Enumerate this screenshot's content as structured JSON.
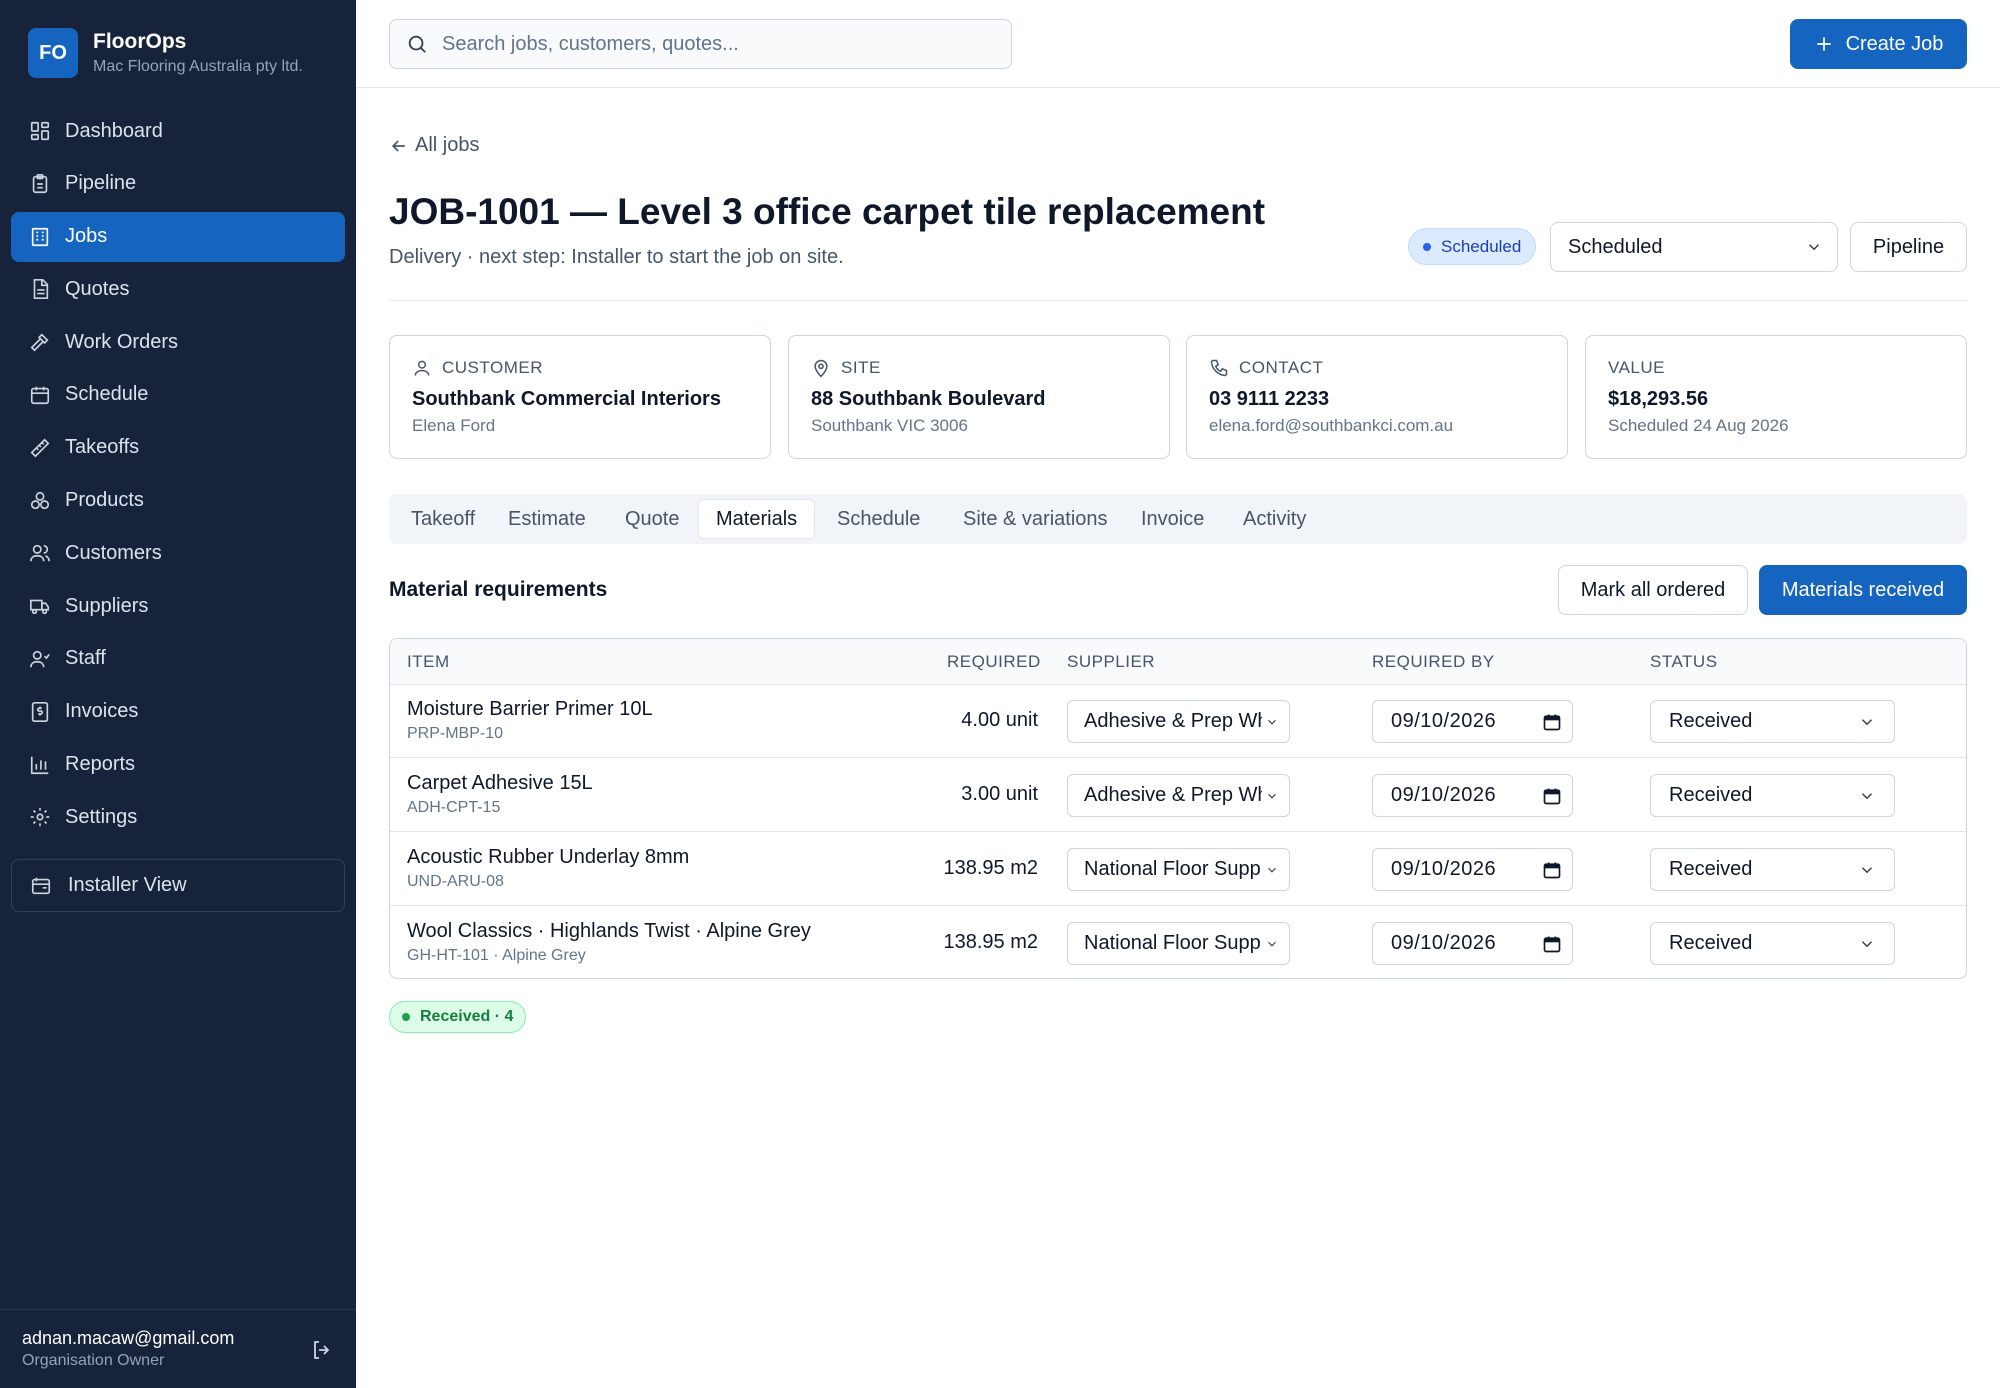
{
  "brand": {
    "logo": "FO",
    "name": "FloorOps",
    "org": "Mac Flooring Australia pty ltd."
  },
  "sidebar": {
    "items": [
      {
        "label": "Dashboard",
        "icon": "dashboard-icon"
      },
      {
        "label": "Pipeline",
        "icon": "clipboard-icon"
      },
      {
        "label": "Jobs",
        "icon": "building-icon",
        "active": true
      },
      {
        "label": "Quotes",
        "icon": "document-icon"
      },
      {
        "label": "Work Orders",
        "icon": "hammer-icon"
      },
      {
        "label": "Schedule",
        "icon": "calendar-icon"
      },
      {
        "label": "Takeoffs",
        "icon": "ruler-icon"
      },
      {
        "label": "Products",
        "icon": "boxes-icon"
      },
      {
        "label": "Customers",
        "icon": "users-icon"
      },
      {
        "label": "Suppliers",
        "icon": "truck-icon"
      },
      {
        "label": "Staff",
        "icon": "staff-icon"
      },
      {
        "label": "Invoices",
        "icon": "invoice-icon"
      },
      {
        "label": "Reports",
        "icon": "bar-chart-icon"
      },
      {
        "label": "Settings",
        "icon": "gear-icon"
      }
    ],
    "installer": "Installer View",
    "user": {
      "email": "adnan.macaw@gmail.com",
      "role": "Organisation Owner"
    }
  },
  "topbar": {
    "search_placeholder": "Search jobs, customers, quotes...",
    "create_label": "Create Job"
  },
  "job": {
    "back_label": "All jobs",
    "title": "JOB-1001 — Level 3 office carpet tile replacement",
    "subtitle": "Delivery · next step: Installer to start the job on site.",
    "status_pill": "Scheduled",
    "status_select": "Scheduled",
    "pipeline_label": "Pipeline"
  },
  "cards": [
    {
      "label": "CUSTOMER",
      "icon": "user-icon",
      "value": "Southbank Commercial Interiors",
      "sub": "Elena Ford"
    },
    {
      "label": "SITE",
      "icon": "map-pin-icon",
      "value": "88 Southbank Boulevard",
      "sub": "Southbank VIC 3006"
    },
    {
      "label": "CONTACT",
      "icon": "phone-icon",
      "value": "03 9111 2233",
      "sub": "elena.ford@southbankci.com.au"
    },
    {
      "label": "VALUE",
      "value": "$18,293.56",
      "sub": "Scheduled 24 Aug 2026"
    }
  ],
  "tabs": [
    "Takeoff",
    "Estimate",
    "Quote",
    "Materials",
    "Schedule",
    "Site & variations",
    "Invoice",
    "Activity"
  ],
  "active_tab": "Materials",
  "materials": {
    "title": "Material requirements",
    "mark_all_label": "Mark all ordered",
    "received_label": "Materials received",
    "columns": [
      "ITEM",
      "REQUIRED",
      "SUPPLIER",
      "REQUIRED BY",
      "STATUS"
    ],
    "rows": [
      {
        "name": "Moisture Barrier Primer 10L",
        "code": "PRP-MBP-10",
        "qty": "4.00 unit",
        "supplier": "Adhesive & Prep Wh",
        "date": "09/10/2026",
        "status": "Received"
      },
      {
        "name": "Carpet Adhesive 15L",
        "code": "ADH-CPT-15",
        "qty": "3.00 unit",
        "supplier": "Adhesive & Prep Wh",
        "date": "09/10/2026",
        "status": "Received"
      },
      {
        "name": "Acoustic Rubber Underlay 8mm",
        "code": "UND-ARU-08",
        "qty": "138.95 m2",
        "supplier": "National Floor Supp",
        "date": "09/10/2026",
        "status": "Received"
      },
      {
        "name": "Wool Classics · Highlands Twist · Alpine Grey",
        "code": "GH-HT-101 · Alpine Grey",
        "qty": "138.95 m2",
        "supplier": "National Floor Supp",
        "date": "09/10/2026",
        "status": "Received"
      }
    ],
    "summary": "Received · 4"
  }
}
